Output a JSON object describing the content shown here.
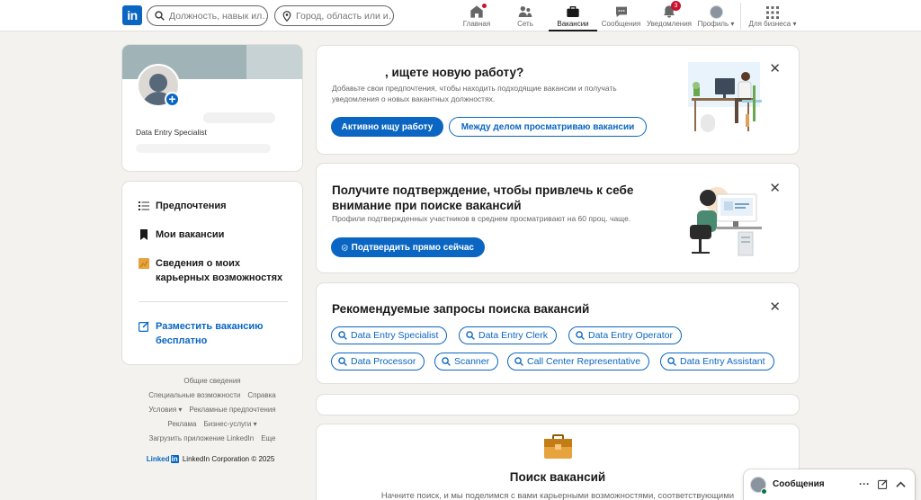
{
  "nav": {
    "logo": "in",
    "search_placeholder": "Должность, навык ил…",
    "location_placeholder": "Город, область или и…",
    "items": [
      {
        "label": "Главная"
      },
      {
        "label": "Сеть"
      },
      {
        "label": "Вакансии"
      },
      {
        "label": "Сообщения"
      },
      {
        "label": "Уведомления",
        "badge": "3"
      },
      {
        "label": "Профиль"
      },
      {
        "label": "Для бизнеса"
      }
    ]
  },
  "profile": {
    "headline": "Data Entry Specialist",
    "add_symbol": "+"
  },
  "sidebar": {
    "preferences": "Предпочтения",
    "my_jobs": "Мои вакансии",
    "career_insights": "Сведения о моих карьерных возможностях",
    "post_job": "Разместить вакансию бесплатно"
  },
  "footer": {
    "links": [
      [
        "Общие сведения"
      ],
      [
        "Специальные возможности",
        "Справка"
      ],
      [
        "Условия ▾",
        "Рекламные предпочтения"
      ],
      [
        "Реклама",
        "Бизнес-услуги ▾"
      ],
      [
        "Загрузить приложение LinkedIn",
        "Еще"
      ]
    ],
    "brand_left": "Linked",
    "brand_in": "in",
    "copyright": "LinkedIn Corporation © 2025"
  },
  "card1": {
    "title": ", ищете новую работу?",
    "text": "Добавьте свои предпочтения, чтобы находить подходящие вакансии и получать уведомления о новых вакантных должностях.",
    "primary": "Активно ищу работу",
    "secondary": "Между делом просматриваю вакансии"
  },
  "card2": {
    "title": "Получите подтверждение, чтобы привлечь к себе внимание при поиске вакансий",
    "text": "Профили подтвержденных участников в среднем просматривают на 60 проц. чаще.",
    "button": "Подтвердить прямо сейчас"
  },
  "card3": {
    "title": "Рекомендуемые запросы поиска вакансий",
    "queries": [
      "Data Entry Specialist",
      "Data Entry Clerk",
      "Data Entry Operator",
      "Data Processor",
      "Scanner",
      "Call Center Representative",
      "Data Entry Assistant"
    ]
  },
  "card5": {
    "title": "Поиск вакансий",
    "text": "Начните поиск, и мы поделимся с вами карьерными возможностями, соответствующими"
  },
  "messaging": {
    "label": "Сообщения",
    "more": "···"
  },
  "colors": {
    "brand": "#0a66c2",
    "background": "#f4f2ee",
    "badge": "#cb112d"
  }
}
